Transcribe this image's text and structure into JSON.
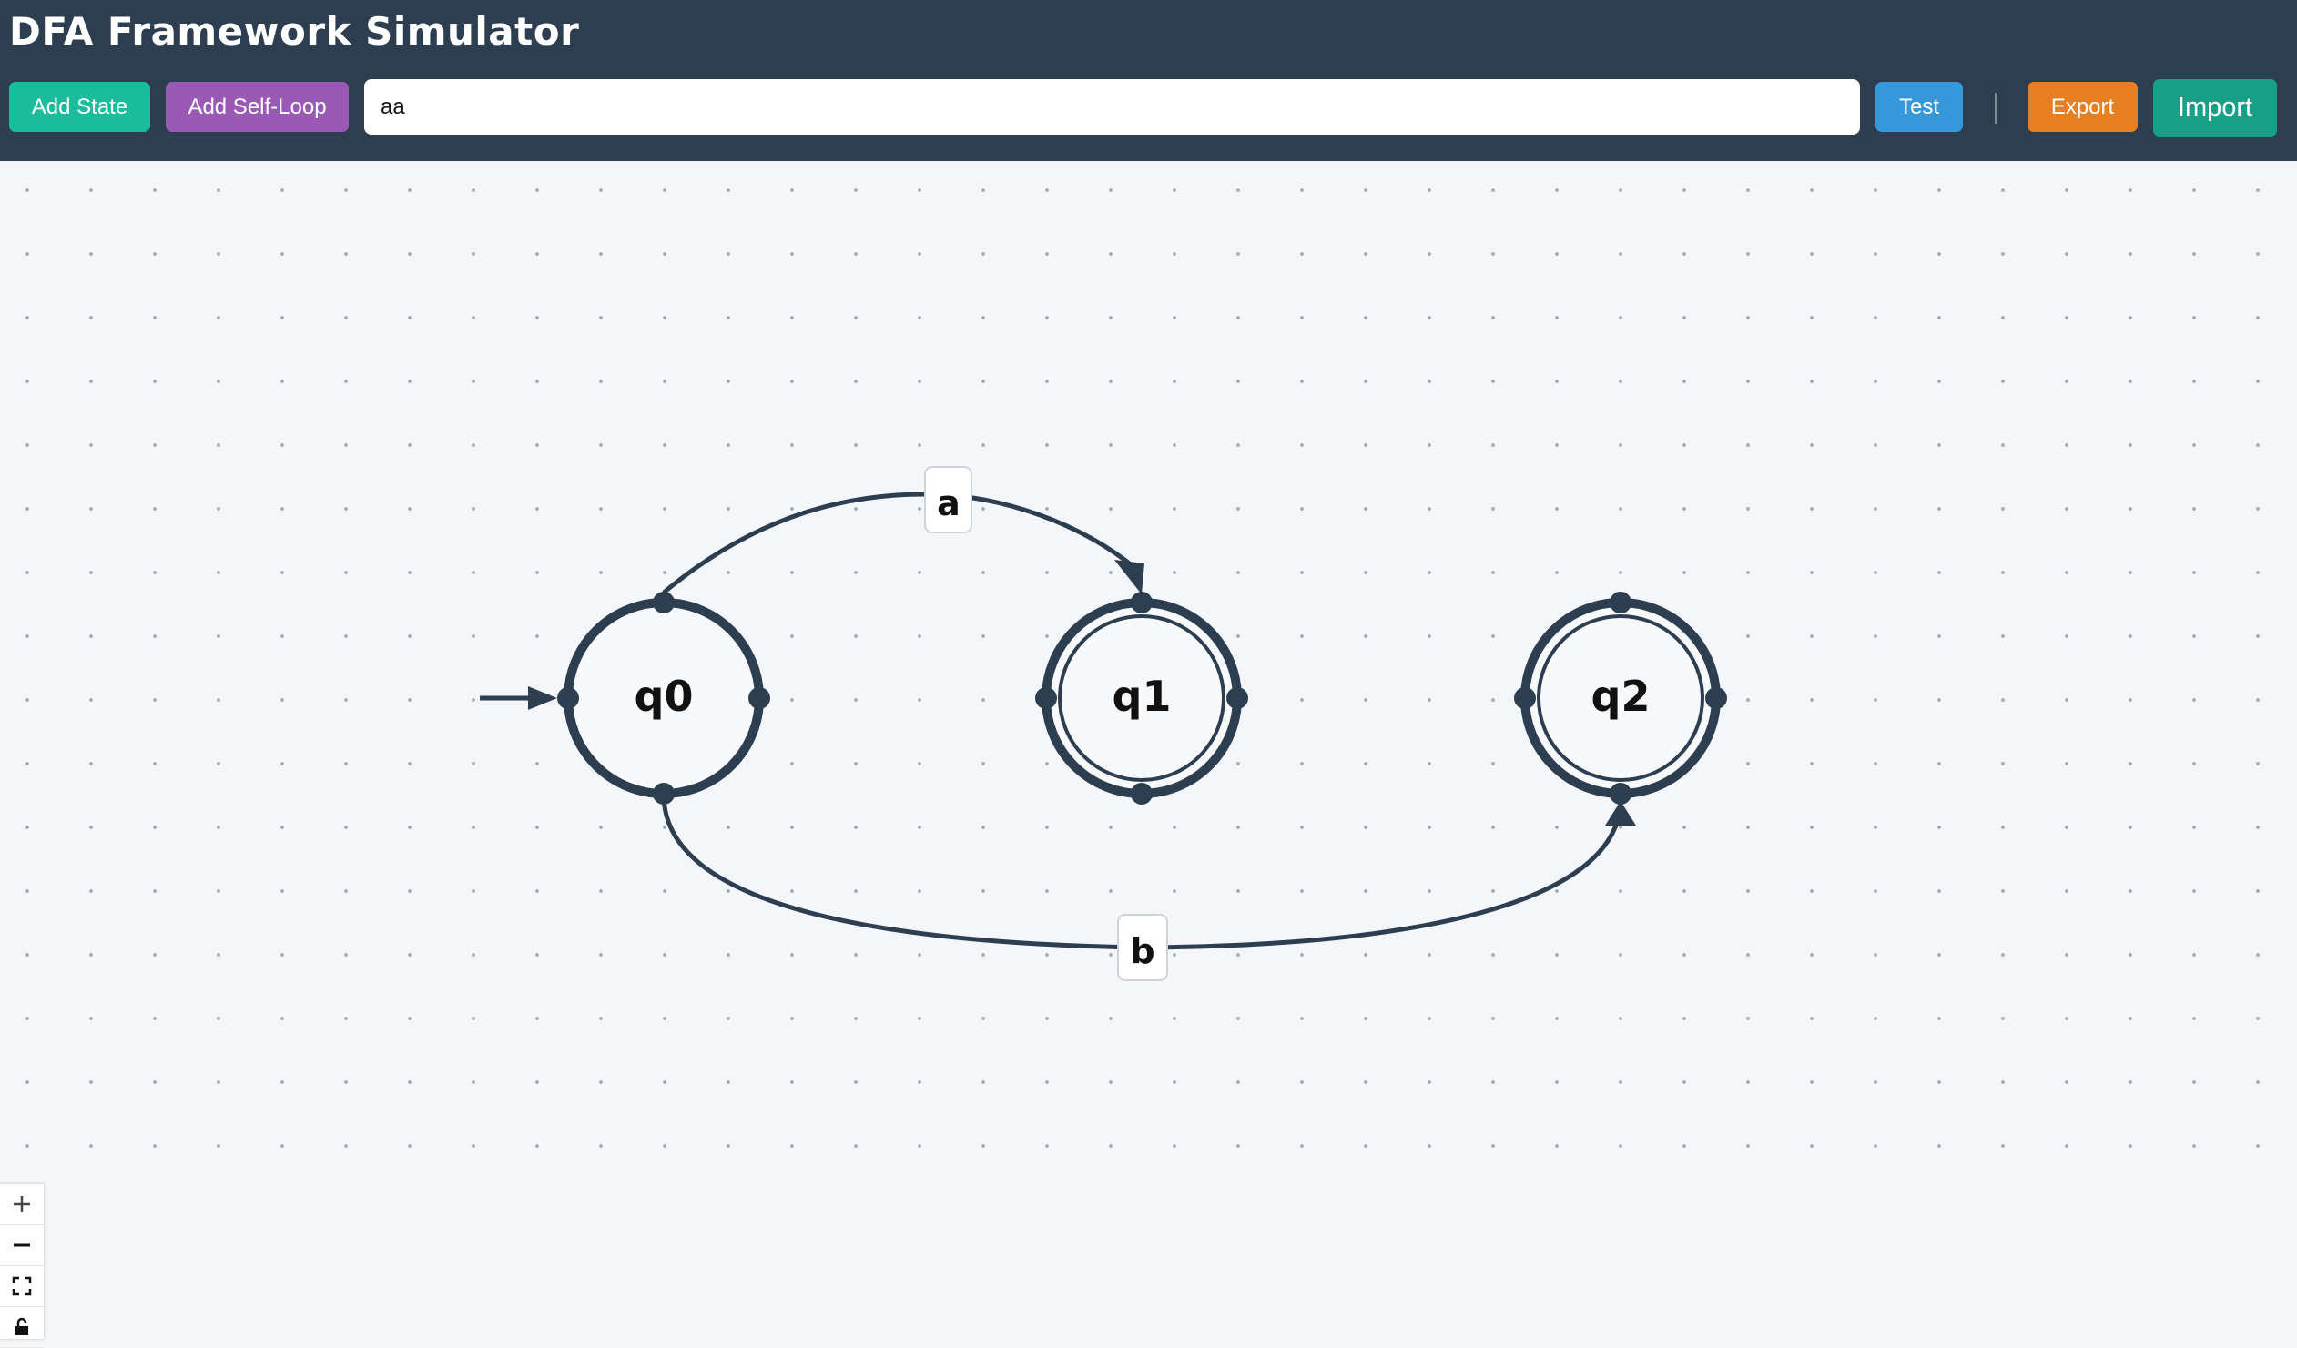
{
  "app": {
    "title": "DFA Framework Simulator"
  },
  "toolbar": {
    "add_state_label": "Add State",
    "add_self_loop_label": "Add Self-Loop",
    "input_value": "aa",
    "test_label": "Test",
    "export_label": "Export",
    "import_label": "Import"
  },
  "colors": {
    "header_bg": "#2c3e50",
    "add_state": "#1abc9c",
    "add_self_loop": "#9b59b6",
    "test": "#3498db",
    "export": "#e67e22",
    "import": "#16a085",
    "state_stroke": "#2c3e50"
  },
  "dfa": {
    "start_state": "q0",
    "states": [
      {
        "id": "q0",
        "label": "q0",
        "accepting": false
      },
      {
        "id": "q1",
        "label": "q1",
        "accepting": true
      },
      {
        "id": "q2",
        "label": "q2",
        "accepting": true
      }
    ],
    "transitions": [
      {
        "from": "q0",
        "to": "q1",
        "symbol": "a"
      },
      {
        "from": "q0",
        "to": "q2",
        "symbol": "b"
      }
    ]
  },
  "zoom_controls": [
    {
      "name": "zoom-in",
      "icon": "plus-icon"
    },
    {
      "name": "zoom-out",
      "icon": "minus-icon"
    },
    {
      "name": "fit-view",
      "icon": "fit-view-icon"
    },
    {
      "name": "toggle-interactivity",
      "icon": "lock-icon"
    }
  ]
}
